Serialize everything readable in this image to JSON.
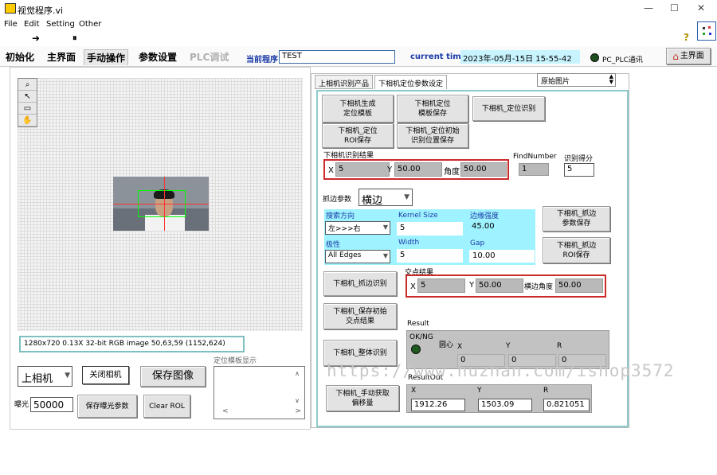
{
  "window": {
    "title": "视觉程序.vi",
    "min": "—",
    "max": "☐",
    "close": "✕"
  },
  "menu": [
    "File",
    "Edit",
    "Setting",
    "Other"
  ],
  "toolbar": {
    "run": "➜",
    "pause": "⏸",
    "help": "?"
  },
  "top_tabs": [
    {
      "label": "初始化"
    },
    {
      "label": "主界面"
    },
    {
      "label": "手动操作"
    },
    {
      "label": "参数设置"
    },
    {
      "label": "PLC调试"
    }
  ],
  "current_program_label": "当前程序",
  "current_program_value": "TEST",
  "current_time_label": "current time",
  "current_time_value": "2023年-05月-15日 15-55-42",
  "plc_status_label": "PC_PLC通讯",
  "home_button": "主界面",
  "image_info": "1280x720 0.13X 32-bit RGB image 50,63,59    (1152,624)",
  "camera_select": "上相机",
  "close_camera_button": "关闭相机",
  "save_image_button": "保存图像",
  "template_display_label": "定位模板显示",
  "exposure_label": "曝光",
  "exposure_value": "50000",
  "save_exposure_button": "保存曝光参数",
  "clear_roi_button": "Clear ROL",
  "right_tabs": [
    "上相机识别产品",
    "下相机定位参数设定"
  ],
  "image_source_select": "原始图片",
  "buttons": {
    "gen_template": "下相机生成\n定位模板",
    "save_template": "下相机定位\n模板保存",
    "locate_identify": "下相机_定位识别",
    "roi_save": "下相机_定位\nROI保存",
    "init_locate_save": "下相机_定位初始\n识别位置保存",
    "edge_param_save": "下相机_抓边\n参数保存",
    "edge_roi_save": "下相机_抓边\nROI保存",
    "edge_identify": "下相机_抓边识别",
    "save_init_intersection": "下相机_保存初始\n交点结果",
    "overall_identify": "下相机_整体识别",
    "manual_offset": "下相机_手动获取\n偏移量"
  },
  "recognition_result": {
    "label": "下相机识别结果",
    "x_label": "X",
    "x_value": "5",
    "y_label": "Y",
    "y_value": "50.00",
    "angle_label": "角度",
    "angle_value": "50.00"
  },
  "find_number": {
    "label": "FindNumber",
    "value": "1"
  },
  "recognition_score": {
    "label": "识别得分",
    "value": "5"
  },
  "edge_params": {
    "label": "抓边参数",
    "mode": "横边",
    "search_dir_label": "搜索方向",
    "search_dir_value": "左>>>右",
    "kernel_label": "Kernel Size",
    "kernel_value": "5",
    "edge_strength_label": "边缘强度",
    "edge_strength_value": "45.00",
    "polarity_label": "极性",
    "polarity_value": "All Edges",
    "width_label": "Width",
    "width_value": "5",
    "gap_label": "Gap",
    "gap_value": "10.00"
  },
  "intersection_result": {
    "label": "交点结果",
    "x_label": "X",
    "x_value": "5",
    "y_label": "Y",
    "y_value": "50.00",
    "angle_label": "横边角度",
    "angle_value": "50.00"
  },
  "result": {
    "label": "Result",
    "okng_label": "OK/NG",
    "circle_label": "圆心",
    "x_label": "X",
    "x_value": "0",
    "y_label": "Y",
    "y_value": "0",
    "r_label": "R",
    "r_value": "0"
  },
  "result_out": {
    "label": "ResultOut",
    "x_label": "X",
    "x_value": "1912.26",
    "y_label": "Y",
    "y_value": "1503.09",
    "r_label": "R",
    "r_value": "0.821051"
  },
  "watermark": "https://www.huzhan.com/ishop3572",
  "colors": {
    "accent_blue": "#1a3aa6",
    "cyan": "#9ff2ff",
    "red_box": "#cc2a2a"
  }
}
